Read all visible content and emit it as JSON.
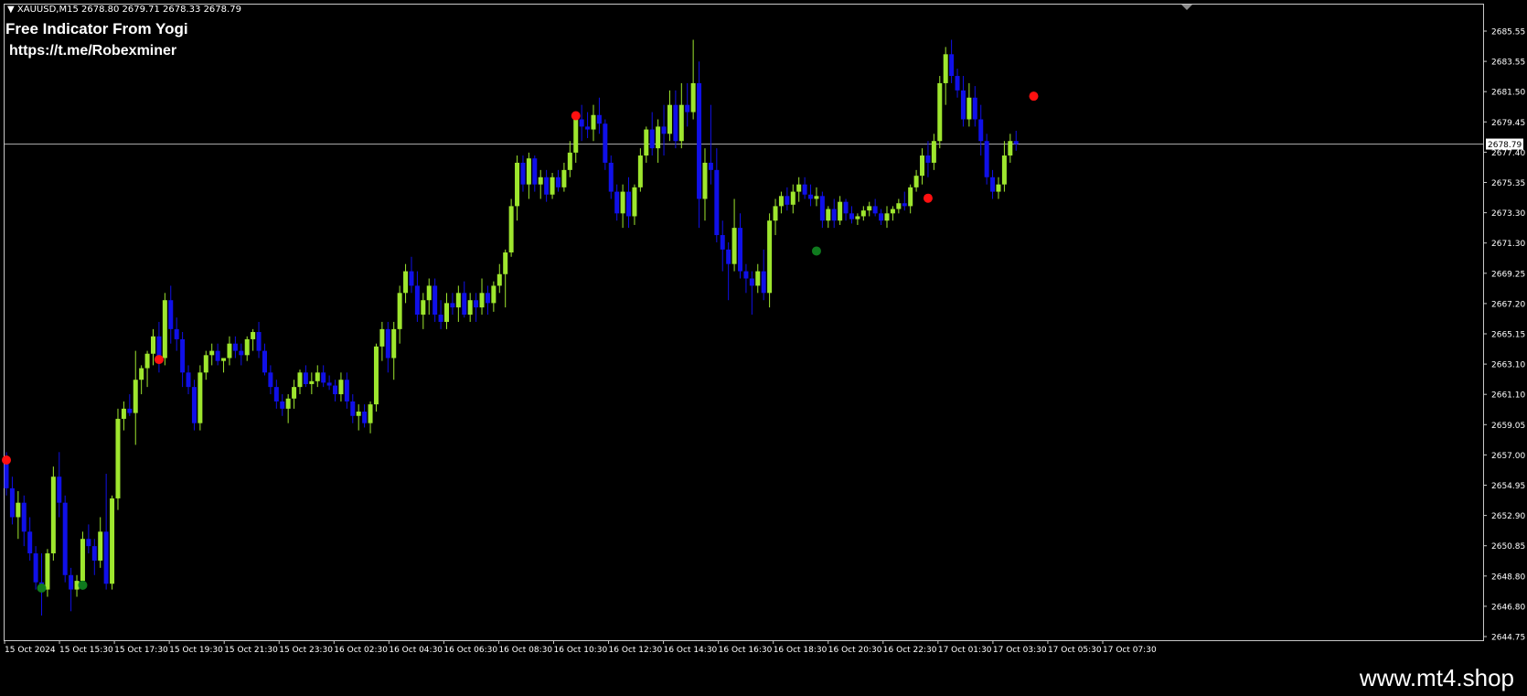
{
  "header": {
    "symbol_line": "XAUUSD,M15  2678.80 2679.71 2678.33 2678.79"
  },
  "overlay": {
    "title": "Free Indicator From Yogi",
    "link": "https://t.me/Robexminer"
  },
  "brand": {
    "text": "www.mt4.shop"
  },
  "colors": {
    "background": "#000000",
    "bull_candle": "#9ee62e",
    "bear_candle": "#1010e8",
    "signal_sell": "#ff1010",
    "signal_buy": "#0f7a1e",
    "grid_text": "#ffffff",
    "current_price_line": "#c0c0c0"
  },
  "chart_data": {
    "type": "candlestick",
    "symbol": "XAUUSD",
    "timeframe": "M15",
    "current_price": 2678.79,
    "current_price_label": "2678.79",
    "ylim": [
      2644.75,
      2686.6
    ],
    "y_ticks": [
      "2685.55",
      "2683.55",
      "2681.50",
      "2679.45",
      "2677.40",
      "2675.35",
      "2673.30",
      "2671.30",
      "2669.25",
      "2667.20",
      "2665.15",
      "2663.10",
      "2661.10",
      "2659.05",
      "2657.00",
      "2654.95",
      "2652.90",
      "2650.85",
      "2648.80",
      "2646.80",
      "2644.75"
    ],
    "x_ticks": [
      "15 Oct 2024",
      "15 Oct 15:30",
      "15 Oct 17:30",
      "15 Oct 19:30",
      "15 Oct 21:30",
      "15 Oct 23:30",
      "16 Oct 02:30",
      "16 Oct 04:30",
      "16 Oct 06:30",
      "16 Oct 08:30",
      "16 Oct 10:30",
      "16 Oct 12:30",
      "16 Oct 14:30",
      "16 Oct 16:30",
      "16 Oct 18:30",
      "16 Oct 20:30",
      "16 Oct 22:30",
      "17 Oct 01:30",
      "17 Oct 03:30",
      "17 Oct 05:30",
      "17 Oct 07:30"
    ],
    "candles": [
      [
        2656.8,
        2657.5,
        2654.5,
        2655.0
      ],
      [
        2655.0,
        2655.8,
        2652.5,
        2653.0
      ],
      [
        2653.0,
        2654.8,
        2651.5,
        2654.0
      ],
      [
        2654.0,
        2654.5,
        2651.0,
        2652.0
      ],
      [
        2652.0,
        2653.0,
        2650.0,
        2650.5
      ],
      [
        2650.5,
        2651.0,
        2648.0,
        2648.5
      ],
      [
        2648.5,
        2650.5,
        2646.2,
        2648.0
      ],
      [
        2648.0,
        2650.8,
        2647.5,
        2650.5
      ],
      [
        2650.5,
        2656.5,
        2650.0,
        2655.8
      ],
      [
        2655.8,
        2657.5,
        2653.0,
        2654.0
      ],
      [
        2654.0,
        2654.5,
        2648.5,
        2649.0
      ],
      [
        2649.0,
        2649.5,
        2646.5,
        2648.0
      ],
      [
        2648.0,
        2649.0,
        2647.5,
        2648.6
      ],
      [
        2648.6,
        2652.0,
        2648.0,
        2651.5
      ],
      [
        2651.5,
        2652.5,
        2650.5,
        2651.0
      ],
      [
        2651.0,
        2651.5,
        2649.0,
        2650.0
      ],
      [
        2650.0,
        2653.0,
        2649.5,
        2652.0
      ],
      [
        2652.0,
        2656.0,
        2648.0,
        2648.4
      ],
      [
        2648.4,
        2654.5,
        2648.0,
        2654.3
      ],
      [
        2654.3,
        2660.5,
        2653.5,
        2659.8
      ],
      [
        2659.8,
        2661.0,
        2659.0,
        2660.5
      ],
      [
        2660.5,
        2661.5,
        2660.0,
        2660.2
      ],
      [
        2660.2,
        2664.5,
        2658.0,
        2662.5
      ],
      [
        2662.5,
        2663.5,
        2661.5,
        2663.3
      ],
      [
        2663.3,
        2664.5,
        2662.0,
        2664.3
      ],
      [
        2664.3,
        2666.0,
        2663.5,
        2665.5
      ],
      [
        2665.5,
        2666.5,
        2663.0,
        2664.0
      ],
      [
        2664.0,
        2668.5,
        2663.5,
        2668.0
      ],
      [
        2668.0,
        2669.0,
        2665.0,
        2666.0
      ],
      [
        2666.0,
        2666.8,
        2664.5,
        2665.3
      ],
      [
        2665.3,
        2665.8,
        2662.0,
        2663.0
      ],
      [
        2663.0,
        2663.5,
        2661.5,
        2662.0
      ],
      [
        2662.0,
        2662.5,
        2659.0,
        2659.5
      ],
      [
        2659.5,
        2663.5,
        2659.0,
        2663.0
      ],
      [
        2663.0,
        2664.5,
        2662.5,
        2664.2
      ],
      [
        2664.2,
        2665.0,
        2663.5,
        2664.5
      ],
      [
        2664.5,
        2665.0,
        2663.5,
        2663.8
      ],
      [
        2663.8,
        2664.0,
        2663.0,
        2664.0
      ],
      [
        2664.0,
        2665.5,
        2663.5,
        2665.0
      ],
      [
        2665.0,
        2665.5,
        2664.0,
        2664.5
      ],
      [
        2664.5,
        2665.0,
        2663.5,
        2664.2
      ],
      [
        2664.2,
        2665.5,
        2663.8,
        2665.3
      ],
      [
        2665.3,
        2666.0,
        2664.5,
        2665.8
      ],
      [
        2665.8,
        2666.5,
        2664.0,
        2664.5
      ],
      [
        2664.5,
        2665.0,
        2662.8,
        2663.0
      ],
      [
        2663.0,
        2663.5,
        2661.5,
        2662.0
      ],
      [
        2662.0,
        2662.5,
        2660.5,
        2661.0
      ],
      [
        2661.0,
        2661.5,
        2660.0,
        2660.5
      ],
      [
        2660.5,
        2661.5,
        2659.5,
        2661.2
      ],
      [
        2661.2,
        2662.5,
        2660.5,
        2662.0
      ],
      [
        2662.0,
        2663.2,
        2661.5,
        2663.0
      ],
      [
        2663.0,
        2663.5,
        2662.0,
        2662.2
      ],
      [
        2662.2,
        2663.0,
        2661.5,
        2662.4
      ],
      [
        2662.4,
        2663.5,
        2662.0,
        2663.0
      ],
      [
        2663.0,
        2663.5,
        2662.0,
        2662.3
      ],
      [
        2662.3,
        2662.8,
        2661.8,
        2662.1
      ],
      [
        2662.1,
        2662.5,
        2661.0,
        2661.5
      ],
      [
        2661.5,
        2663.0,
        2661.0,
        2662.5
      ],
      [
        2662.5,
        2663.0,
        2660.5,
        2661.0
      ],
      [
        2661.0,
        2661.5,
        2659.5,
        2660.0
      ],
      [
        2660.0,
        2660.8,
        2659.0,
        2660.3
      ],
      [
        2660.3,
        2660.8,
        2659.2,
        2659.5
      ],
      [
        2659.5,
        2661.0,
        2658.8,
        2660.8
      ],
      [
        2660.8,
        2665.0,
        2660.3,
        2664.8
      ],
      [
        2664.8,
        2666.5,
        2663.8,
        2666.0
      ],
      [
        2666.0,
        2666.5,
        2663.0,
        2664.0
      ],
      [
        2664.0,
        2666.5,
        2662.5,
        2666.0
      ],
      [
        2666.0,
        2669.0,
        2665.0,
        2668.5
      ],
      [
        2668.5,
        2670.5,
        2667.8,
        2670.0
      ],
      [
        2670.0,
        2671.0,
        2668.5,
        2669.0
      ],
      [
        2669.0,
        2670.0,
        2666.5,
        2667.0
      ],
      [
        2667.0,
        2668.5,
        2666.0,
        2668.0
      ],
      [
        2668.0,
        2669.5,
        2667.0,
        2669.0
      ],
      [
        2669.0,
        2669.5,
        2666.5,
        2667.0
      ],
      [
        2667.0,
        2668.0,
        2666.0,
        2666.5
      ],
      [
        2666.5,
        2668.5,
        2666.0,
        2667.8
      ],
      [
        2667.8,
        2668.5,
        2667.0,
        2667.5
      ],
      [
        2667.5,
        2669.0,
        2666.5,
        2668.5
      ],
      [
        2668.5,
        2669.3,
        2666.8,
        2667.0
      ],
      [
        2667.0,
        2668.5,
        2666.5,
        2668.0
      ],
      [
        2668.0,
        2668.5,
        2666.5,
        2667.5
      ],
      [
        2667.5,
        2669.5,
        2667.0,
        2668.5
      ],
      [
        2668.5,
        2669.0,
        2667.0,
        2667.8
      ],
      [
        2667.8,
        2669.3,
        2667.2,
        2669.0
      ],
      [
        2669.0,
        2670.5,
        2668.5,
        2669.8
      ],
      [
        2669.8,
        2671.5,
        2667.5,
        2671.3
      ],
      [
        2671.3,
        2675.0,
        2671.0,
        2674.5
      ],
      [
        2674.5,
        2678.0,
        2673.5,
        2677.5
      ],
      [
        2677.5,
        2678.0,
        2675.5,
        2676.0
      ],
      [
        2676.0,
        2678.2,
        2675.0,
        2677.8
      ],
      [
        2677.8,
        2678.0,
        2675.5,
        2676.0
      ],
      [
        2676.0,
        2677.0,
        2675.0,
        2676.5
      ],
      [
        2676.5,
        2677.0,
        2674.8,
        2675.3
      ],
      [
        2675.3,
        2676.8,
        2675.0,
        2676.5
      ],
      [
        2676.5,
        2677.0,
        2675.5,
        2675.8
      ],
      [
        2675.8,
        2677.5,
        2675.5,
        2677.0
      ],
      [
        2677.0,
        2679.0,
        2676.5,
        2678.2
      ],
      [
        2678.2,
        2681.0,
        2677.5,
        2680.5
      ],
      [
        2680.5,
        2681.5,
        2679.0,
        2680.0
      ],
      [
        2680.0,
        2681.0,
        2679.2,
        2679.8
      ],
      [
        2679.8,
        2681.5,
        2679.0,
        2680.8
      ],
      [
        2680.8,
        2682.0,
        2679.5,
        2680.2
      ],
      [
        2680.2,
        2680.5,
        2677.0,
        2677.5
      ],
      [
        2677.5,
        2678.0,
        2675.0,
        2675.5
      ],
      [
        2675.5,
        2676.0,
        2673.5,
        2674.0
      ],
      [
        2674.0,
        2676.0,
        2673.0,
        2675.5
      ],
      [
        2675.5,
        2676.5,
        2673.0,
        2673.8
      ],
      [
        2673.8,
        2676.0,
        2673.2,
        2675.8
      ],
      [
        2675.8,
        2678.5,
        2675.5,
        2678.0
      ],
      [
        2678.0,
        2680.0,
        2677.5,
        2679.8
      ],
      [
        2679.8,
        2681.0,
        2678.0,
        2678.5
      ],
      [
        2678.5,
        2680.5,
        2677.5,
        2680.0
      ],
      [
        2680.0,
        2681.5,
        2678.0,
        2679.5
      ],
      [
        2679.5,
        2682.5,
        2679.0,
        2681.5
      ],
      [
        2681.5,
        2682.5,
        2678.5,
        2679.0
      ],
      [
        2679.0,
        2683.0,
        2678.5,
        2681.5
      ],
      [
        2681.5,
        2683.0,
        2680.0,
        2681.0
      ],
      [
        2681.0,
        2686.0,
        2680.5,
        2683.0
      ],
      [
        2683.0,
        2684.5,
        2673.0,
        2675.0
      ],
      [
        2675.0,
        2678.5,
        2673.5,
        2677.5
      ],
      [
        2677.5,
        2681.5,
        2676.0,
        2677.0
      ],
      [
        2677.0,
        2678.5,
        2672.0,
        2672.5
      ],
      [
        2672.5,
        2673.5,
        2670.0,
        2671.5
      ],
      [
        2671.5,
        2672.0,
        2668.0,
        2670.5
      ],
      [
        2670.5,
        2675.0,
        2670.0,
        2673.0
      ],
      [
        2673.0,
        2674.0,
        2669.5,
        2670.0
      ],
      [
        2670.0,
        2670.5,
        2668.5,
        2669.5
      ],
      [
        2669.5,
        2670.0,
        2667.0,
        2669.0
      ],
      [
        2669.0,
        2670.5,
        2668.5,
        2670.0
      ],
      [
        2670.0,
        2671.5,
        2668.0,
        2668.5
      ],
      [
        2668.5,
        2674.0,
        2667.5,
        2673.5
      ],
      [
        2673.5,
        2675.0,
        2672.5,
        2674.5
      ],
      [
        2674.5,
        2675.5,
        2674.0,
        2675.2
      ],
      [
        2675.2,
        2675.8,
        2674.2,
        2674.6
      ],
      [
        2674.6,
        2676.0,
        2674.0,
        2675.5
      ],
      [
        2675.5,
        2676.5,
        2674.8,
        2676.0
      ],
      [
        2676.0,
        2676.5,
        2675.0,
        2675.3
      ],
      [
        2675.3,
        2676.0,
        2674.5,
        2675.0
      ],
      [
        2675.0,
        2675.8,
        2674.5,
        2675.2
      ],
      [
        2675.2,
        2675.5,
        2673.0,
        2673.5
      ],
      [
        2673.5,
        2674.5,
        2673.0,
        2674.3
      ],
      [
        2674.3,
        2675.0,
        2673.0,
        2673.5
      ],
      [
        2673.5,
        2675.2,
        2673.2,
        2674.8
      ],
      [
        2674.8,
        2675.0,
        2673.5,
        2674.0
      ],
      [
        2674.0,
        2674.5,
        2673.3,
        2673.6
      ],
      [
        2673.6,
        2674.0,
        2673.2,
        2673.8
      ],
      [
        2673.8,
        2674.5,
        2673.5,
        2674.2
      ],
      [
        2674.2,
        2674.8,
        2673.8,
        2674.5
      ],
      [
        2674.5,
        2675.0,
        2673.8,
        2674.0
      ],
      [
        2674.0,
        2674.3,
        2673.2,
        2673.5
      ],
      [
        2673.5,
        2674.5,
        2673.0,
        2674.0
      ],
      [
        2674.0,
        2674.5,
        2673.5,
        2674.3
      ],
      [
        2674.3,
        2675.0,
        2674.0,
        2674.7
      ],
      [
        2674.7,
        2675.5,
        2674.2,
        2674.5
      ],
      [
        2674.5,
        2676.0,
        2674.0,
        2675.8
      ],
      [
        2675.8,
        2677.0,
        2675.5,
        2676.6
      ],
      [
        2676.6,
        2678.5,
        2676.0,
        2678.0
      ],
      [
        2678.0,
        2679.0,
        2676.5,
        2677.5
      ],
      [
        2677.5,
        2679.5,
        2677.0,
        2679.0
      ],
      [
        2679.0,
        2683.5,
        2678.5,
        2683.0
      ],
      [
        2683.0,
        2685.5,
        2681.5,
        2685.0
      ],
      [
        2685.0,
        2686.0,
        2683.0,
        2683.5
      ],
      [
        2683.5,
        2684.0,
        2682.0,
        2682.5
      ],
      [
        2682.5,
        2683.5,
        2680.0,
        2680.5
      ],
      [
        2680.5,
        2683.0,
        2680.0,
        2682.0
      ],
      [
        2682.0,
        2682.8,
        2680.0,
        2680.5
      ],
      [
        2680.5,
        2681.5,
        2678.0,
        2679.0
      ],
      [
        2679.0,
        2679.5,
        2676.0,
        2676.5
      ],
      [
        2676.5,
        2677.0,
        2675.0,
        2675.5
      ],
      [
        2675.5,
        2676.5,
        2675.0,
        2676.0
      ],
      [
        2676.0,
        2679.0,
        2675.5,
        2678.0
      ],
      [
        2678.0,
        2679.5,
        2677.5,
        2679.0
      ],
      [
        2679.0,
        2679.71,
        2678.33,
        2678.79
      ]
    ],
    "signals": [
      {
        "type": "sell",
        "candle": 0,
        "price": 2656.95
      },
      {
        "type": "buy",
        "candle": 6,
        "price": 2648.1
      },
      {
        "type": "buy",
        "candle": 13,
        "price": 2648.3
      },
      {
        "type": "sell",
        "candle": 26,
        "price": 2663.9
      },
      {
        "type": "sell",
        "candle": 97,
        "price": 2680.75
      },
      {
        "type": "buy",
        "candle": 138,
        "price": 2671.4
      },
      {
        "type": "sell",
        "candle": 157,
        "price": 2675.05
      },
      {
        "type": "sell",
        "candle": 175,
        "price": 2682.1
      }
    ]
  }
}
